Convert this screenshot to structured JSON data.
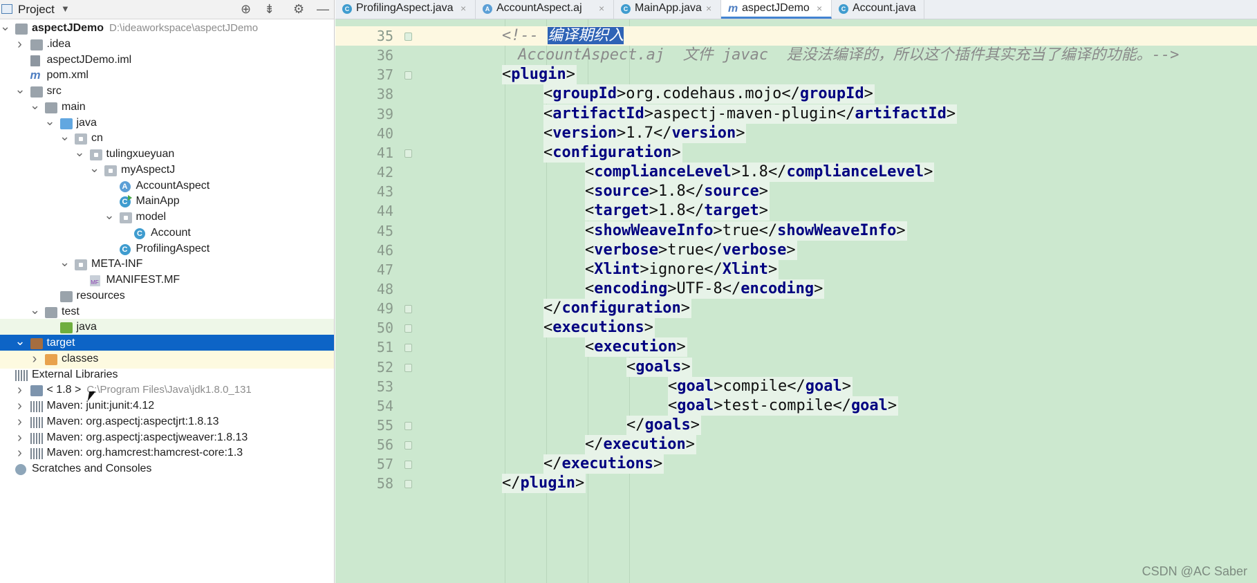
{
  "project_panel": {
    "title": "Project",
    "tree": [
      {
        "depth": 0,
        "arrow": "down",
        "icon": "module-folder-icon",
        "label": "aspectJDemo",
        "hint": "D:\\ideaworkspace\\aspectJDemo",
        "bold": true
      },
      {
        "depth": 1,
        "arrow": "right",
        "icon": "folder-icon",
        "label": ".idea"
      },
      {
        "depth": 1,
        "arrow": "",
        "icon": "iml-file-icon",
        "label": "aspectJDemo.iml"
      },
      {
        "depth": 1,
        "arrow": "",
        "icon": "maven-file-icon",
        "label": "pom.xml"
      },
      {
        "depth": 1,
        "arrow": "down",
        "icon": "folder-icon",
        "label": "src"
      },
      {
        "depth": 2,
        "arrow": "down",
        "icon": "folder-icon",
        "label": "main"
      },
      {
        "depth": 3,
        "arrow": "down",
        "icon": "source-folder-icon",
        "label": "java"
      },
      {
        "depth": 4,
        "arrow": "down",
        "icon": "package-icon",
        "label": "cn"
      },
      {
        "depth": 5,
        "arrow": "down",
        "icon": "package-icon",
        "label": "tulingxueyuan"
      },
      {
        "depth": 6,
        "arrow": "down",
        "icon": "package-icon",
        "label": "myAspectJ"
      },
      {
        "depth": 7,
        "arrow": "",
        "icon": "aspect-icon",
        "label": "AccountAspect"
      },
      {
        "depth": 7,
        "arrow": "",
        "icon": "main-class-icon",
        "label": "MainApp"
      },
      {
        "depth": 7,
        "arrow": "down",
        "icon": "package-icon",
        "label": "model"
      },
      {
        "depth": 8,
        "arrow": "",
        "icon": "class-icon",
        "label": "Account"
      },
      {
        "depth": 7,
        "arrow": "",
        "icon": "class-icon",
        "label": "ProfilingAspect"
      },
      {
        "depth": 4,
        "arrow": "down",
        "icon": "package-icon",
        "label": "META-INF"
      },
      {
        "depth": 5,
        "arrow": "",
        "icon": "manifest-file-icon",
        "label": "MANIFEST.MF"
      },
      {
        "depth": 3,
        "arrow": "",
        "icon": "resources-folder-icon",
        "label": "resources"
      },
      {
        "depth": 2,
        "arrow": "down",
        "icon": "folder-icon",
        "label": "test"
      },
      {
        "depth": 3,
        "arrow": "",
        "icon": "test-folder-icon",
        "label": "java",
        "highlight": "green"
      },
      {
        "depth": 1,
        "arrow": "down",
        "icon": "excluded-folder-icon",
        "label": "target",
        "selected": true
      },
      {
        "depth": 2,
        "arrow": "right",
        "icon": "orange-folder-icon",
        "label": "classes",
        "highlight": "yellow"
      },
      {
        "depth": 0,
        "arrow": "",
        "icon": "libraries-icon",
        "label": "External Libraries"
      },
      {
        "depth": 1,
        "arrow": "right",
        "icon": "jdk-icon",
        "label": "< 1.8 >",
        "hint": "C:\\Program Files\\Java\\jdk1.8.0_131"
      },
      {
        "depth": 1,
        "arrow": "right",
        "icon": "library-icon",
        "label": "Maven: junit:junit:4.12"
      },
      {
        "depth": 1,
        "arrow": "right",
        "icon": "library-icon",
        "label": "Maven: org.aspectj:aspectjrt:1.8.13"
      },
      {
        "depth": 1,
        "arrow": "right",
        "icon": "library-icon",
        "label": "Maven: org.aspectj:aspectjweaver:1.8.13"
      },
      {
        "depth": 1,
        "arrow": "right",
        "icon": "library-icon",
        "label": "Maven: org.hamcrest:hamcrest-core:1.3"
      },
      {
        "depth": 0,
        "arrow": "",
        "icon": "scratches-icon",
        "label": "Scratches and Consoles"
      }
    ]
  },
  "tabs": [
    {
      "label": "ProfilingAspect.java",
      "icon": "class-icon",
      "active": false
    },
    {
      "label": "AccountAspect.aj",
      "icon": "aspect-icon",
      "active": false
    },
    {
      "label": "MainApp.java",
      "icon": "main-class-icon",
      "active": false
    },
    {
      "label": "aspectJDemo",
      "icon": "maven-file-icon",
      "active": true
    },
    {
      "label": "Account.java",
      "icon": "class-icon",
      "active": false
    }
  ],
  "editor": {
    "lines": [
      {
        "num": "35",
        "indent": 2,
        "kind": "comment",
        "text": "<!-- ",
        "selected": "编译期织入",
        "current": true
      },
      {
        "num": "36",
        "indent": 2,
        "kind": "comment",
        "text": " AccountAspect.aj  文件 javac  是没法编译的，所以这个插件其实充当了编译的功能。-->"
      },
      {
        "num": "37",
        "indent": 2,
        "kind": "tag",
        "open": "<",
        "name": "plugin",
        "close": ">"
      },
      {
        "num": "38",
        "indent": 3,
        "kind": "element",
        "name": "groupId",
        "value": "org.codehaus.mojo"
      },
      {
        "num": "39",
        "indent": 3,
        "kind": "element",
        "name": "artifactId",
        "value": "aspectj-maven-plugin"
      },
      {
        "num": "40",
        "indent": 3,
        "kind": "element",
        "name": "version",
        "value": "1.7"
      },
      {
        "num": "41",
        "indent": 3,
        "kind": "tag",
        "open": "<",
        "name": "configuration",
        "close": ">"
      },
      {
        "num": "42",
        "indent": 4,
        "kind": "element",
        "name": "complianceLevel",
        "value": "1.8"
      },
      {
        "num": "43",
        "indent": 4,
        "kind": "element",
        "name": "source",
        "value": "1.8"
      },
      {
        "num": "44",
        "indent": 4,
        "kind": "element",
        "name": "target",
        "value": "1.8"
      },
      {
        "num": "45",
        "indent": 4,
        "kind": "element",
        "name": "showWeaveInfo",
        "value": "true"
      },
      {
        "num": "46",
        "indent": 4,
        "kind": "element",
        "name": "verbose",
        "value": "true"
      },
      {
        "num": "47",
        "indent": 4,
        "kind": "element",
        "name": "Xlint",
        "value": "ignore"
      },
      {
        "num": "48",
        "indent": 4,
        "kind": "element",
        "name": "encoding",
        "value": "UTF-8"
      },
      {
        "num": "49",
        "indent": 3,
        "kind": "tag",
        "open": "</",
        "name": "configuration",
        "close": ">"
      },
      {
        "num": "50",
        "indent": 3,
        "kind": "tag",
        "open": "<",
        "name": "executions",
        "close": ">"
      },
      {
        "num": "51",
        "indent": 4,
        "kind": "tag",
        "open": "<",
        "name": "execution",
        "close": ">"
      },
      {
        "num": "52",
        "indent": 5,
        "kind": "tag",
        "open": "<",
        "name": "goals",
        "close": ">"
      },
      {
        "num": "53",
        "indent": 6,
        "kind": "element",
        "name": "goal",
        "value": "compile"
      },
      {
        "num": "54",
        "indent": 6,
        "kind": "element",
        "name": "goal",
        "value": "test-compile"
      },
      {
        "num": "55",
        "indent": 5,
        "kind": "tag",
        "open": "</",
        "name": "goals",
        "close": ">"
      },
      {
        "num": "56",
        "indent": 4,
        "kind": "tag",
        "open": "</",
        "name": "execution",
        "close": ">"
      },
      {
        "num": "57",
        "indent": 3,
        "kind": "tag",
        "open": "</",
        "name": "executions",
        "close": ">"
      },
      {
        "num": "58",
        "indent": 2,
        "kind": "tag",
        "open": "</",
        "name": "plugin",
        "close": ">"
      }
    ]
  },
  "watermark": "CSDN @AC Saber",
  "colors": {
    "editor_bg": "#cce8cf",
    "selection_blue": "#0d64c6",
    "tag_color": "#000080",
    "comment_color": "#8a8a8a"
  }
}
